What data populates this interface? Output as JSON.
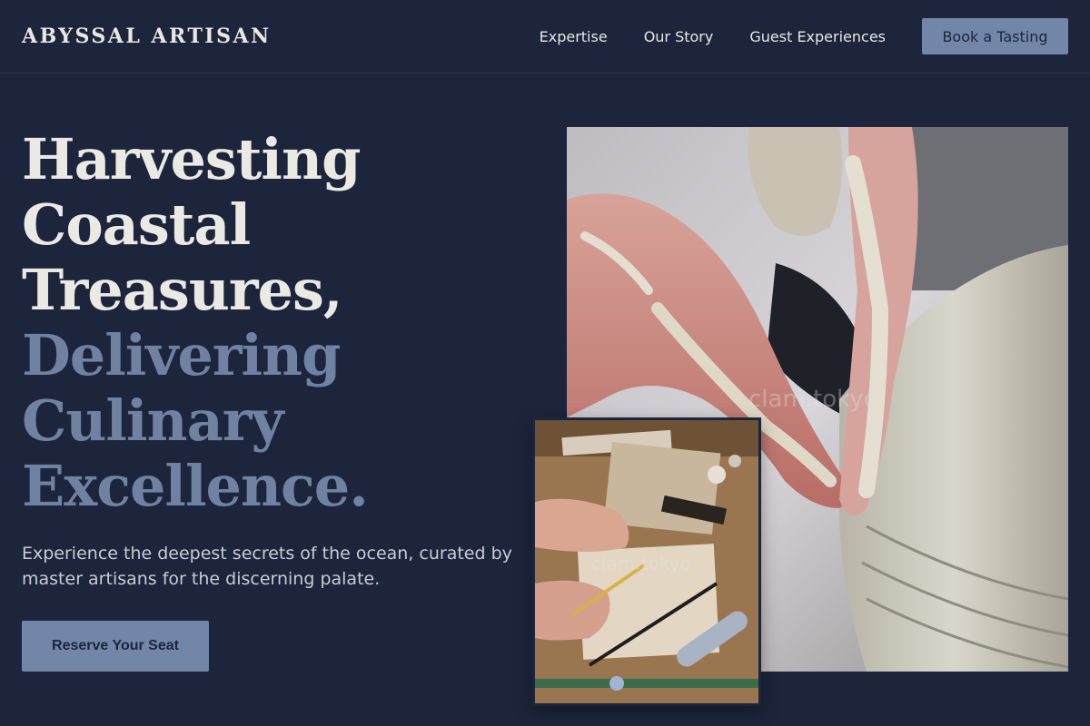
{
  "brand": {
    "name": "ABYSSAL ARTISAN"
  },
  "nav": {
    "links": [
      {
        "label": "Expertise"
      },
      {
        "label": "Our Story"
      },
      {
        "label": "Guest Experiences"
      }
    ],
    "cta_label": "Book a Tasting"
  },
  "hero": {
    "title_lines_light": [
      "Harvesting",
      "Coastal",
      "Treasures,"
    ],
    "title_lines_accent": [
      "Delivering",
      "Culinary",
      "Excellence."
    ],
    "subtitle": "Experience the deepest secrets of the ocean, curated by master artisans for the discerning palate.",
    "cta_label": "Reserve Your Seat"
  },
  "images": {
    "main": {
      "watermark": "clam.tokyo"
    },
    "inset": {
      "watermark": "clam.tokyo"
    }
  },
  "colors": {
    "background": "#1c253c",
    "accent": "#7286a8",
    "title_light": "#ebe9e3",
    "title_accent": "#6f82a2"
  }
}
